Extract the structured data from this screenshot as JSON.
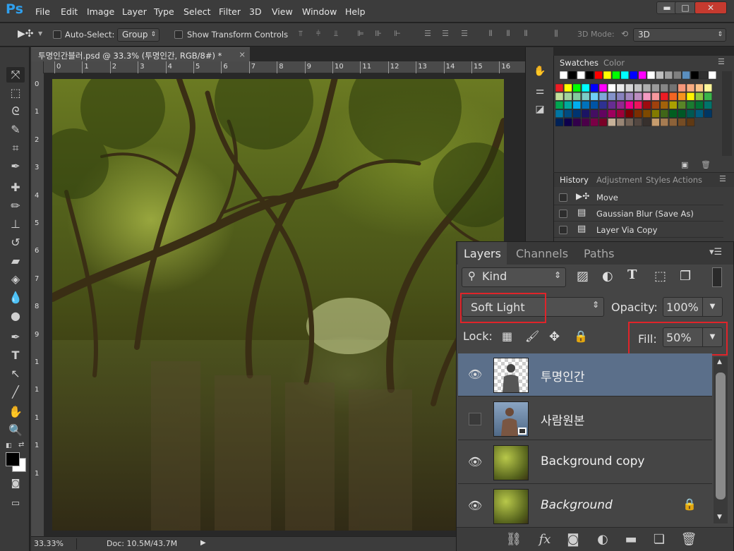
{
  "app": {
    "logo": "Ps"
  },
  "menu": [
    "File",
    "Edit",
    "Image",
    "Layer",
    "Type",
    "Select",
    "Filter",
    "3D",
    "View",
    "Window",
    "Help"
  ],
  "window_controls": {
    "minimize": "▬",
    "maximize": "□",
    "close": "✕"
  },
  "options": {
    "auto_select_label": "Auto-Select:",
    "auto_select_value": "Group",
    "transform_label": "Show Transform Controls",
    "mode_label": "3D Mode:",
    "mode_value": "3D"
  },
  "document": {
    "tab_title": "투명인간블러.psd @ 33.3% (투명인간, RGB/8#) *",
    "close": "×"
  },
  "ruler": {
    "h_ticks": [
      "0",
      "1",
      "2",
      "3",
      "4",
      "5",
      "6",
      "7",
      "8",
      "9",
      "10",
      "11",
      "12",
      "13",
      "14",
      "15",
      "16"
    ],
    "v_ticks": [
      "0",
      "1",
      "2",
      "3",
      "4",
      "5",
      "6",
      "7",
      "8",
      "9",
      "1",
      "1",
      "1",
      "1",
      "1"
    ]
  },
  "status": {
    "zoom": "33.33%",
    "doc": "Doc: 10.5M/43.7M"
  },
  "swatches": {
    "tab_swatches": "Swatches",
    "tab_color": "Color",
    "row1": [
      "#ffffff",
      "#000000",
      "#ffffff",
      "#000000",
      "#ff0000",
      "#ffff00",
      "#00ff00",
      "#00ffff",
      "#0000ff",
      "#ff00ff",
      "#ffffff",
      "#c0c0c0",
      "#a0a0a0",
      "#808080",
      "#5a8fc0",
      "#000000",
      "#303030",
      "#ffffff"
    ],
    "colors": [
      "#ed1c24",
      "#ffff00",
      "#00ff00",
      "#00ffff",
      "#0000ff",
      "#ff00ff",
      "#ffffff",
      "#ebebeb",
      "#d7d7d7",
      "#c3c3c3",
      "#afafaf",
      "#9b9b9b",
      "#878787",
      "#737373",
      "#f7977a",
      "#f9ad81",
      "#fdc68a",
      "#fff79a",
      "#c4df9b",
      "#a2d39c",
      "#82ca9d",
      "#7bcdc8",
      "#6ecff6",
      "#7ea7d8",
      "#8493ca",
      "#8882be",
      "#a187be",
      "#bc8dbf",
      "#f49ac2",
      "#f6989d",
      "#ed1c24",
      "#f26522",
      "#f7941d",
      "#fff200",
      "#8dc73f",
      "#39b54a",
      "#00a651",
      "#00a99d",
      "#00aeef",
      "#0072bc",
      "#0054a6",
      "#2e3192",
      "#662d91",
      "#92278f",
      "#ec008c",
      "#ed145b",
      "#9e0b0f",
      "#a0410d",
      "#a3620a",
      "#aba000",
      "#598527",
      "#1a7b30",
      "#007236",
      "#00746b",
      "#0076a3",
      "#004b80",
      "#003471",
      "#1b1464",
      "#440e62",
      "#630460",
      "#9e005d",
      "#9e0039",
      "#790000",
      "#7b2e00",
      "#7d4900",
      "#827b00",
      "#406618",
      "#005e20",
      "#005826",
      "#005952",
      "#005b7f",
      "#003663",
      "#002157",
      "#0d004c",
      "#32004b",
      "#4b0049",
      "#7b0046",
      "#7a0026",
      "#c7b299",
      "#998675",
      "#736357",
      "#534741",
      "#37302d",
      "#c69c6d",
      "#a67c52",
      "#8c6239",
      "#754c24",
      "#603913"
    ]
  },
  "history": {
    "tab_history": "History",
    "tab_adjustments": "Adjustments",
    "tab_styles": "Styles",
    "tab_actions": "Actions",
    "items": [
      {
        "label": "Move",
        "icon": "move-tool-icon"
      },
      {
        "label": "Gaussian Blur (Save As)",
        "icon": "document-icon"
      },
      {
        "label": "Layer Via Copy",
        "icon": "document-icon"
      }
    ]
  },
  "layers": {
    "tab_layers": "Layers",
    "tab_channels": "Channels",
    "tab_paths": "Paths",
    "filter_kind": "Kind",
    "blend_mode": "Soft Light",
    "opacity_label": "Opacity:",
    "opacity_value": "100%",
    "lock_label": "Lock:",
    "fill_label": "Fill:",
    "fill_value": "50%",
    "rows": [
      {
        "name": "투명인간",
        "visible": true,
        "selected": true,
        "italic": false,
        "locked": false,
        "thumb": "person"
      },
      {
        "name": "사람원본",
        "visible": false,
        "selected": false,
        "italic": false,
        "locked": false,
        "thumb": "person-color"
      },
      {
        "name": "Background copy",
        "visible": true,
        "selected": false,
        "italic": false,
        "locked": false,
        "thumb": "forest"
      },
      {
        "name": "Background",
        "visible": true,
        "selected": false,
        "italic": true,
        "locked": true,
        "thumb": "forest"
      }
    ]
  }
}
